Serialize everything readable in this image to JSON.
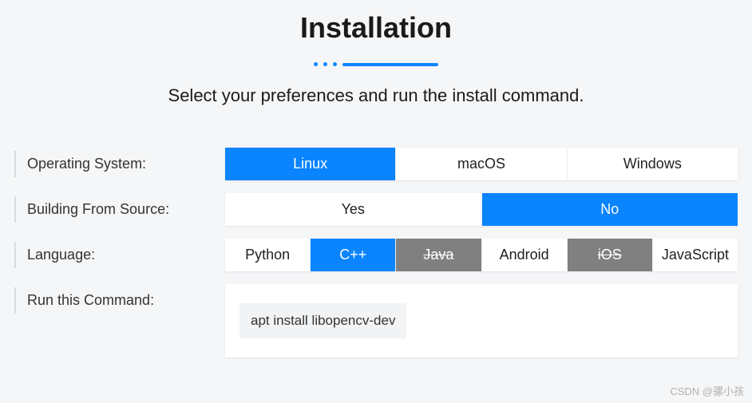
{
  "header": {
    "title": "Installation",
    "subtitle": "Select your preferences and run the install command."
  },
  "labels": {
    "os": "Operating System:",
    "source": "Building From Source:",
    "language": "Language:",
    "command": "Run this Command:"
  },
  "os_options": [
    {
      "label": "Linux",
      "state": "selected"
    },
    {
      "label": "macOS",
      "state": "normal"
    },
    {
      "label": "Windows",
      "state": "normal"
    }
  ],
  "source_options": [
    {
      "label": "Yes",
      "state": "normal"
    },
    {
      "label": "No",
      "state": "selected"
    }
  ],
  "language_options": [
    {
      "label": "Python",
      "state": "normal"
    },
    {
      "label": "C++",
      "state": "selected"
    },
    {
      "label": "Java",
      "state": "disabled"
    },
    {
      "label": "Android",
      "state": "normal"
    },
    {
      "label": "iOS",
      "state": "disabled"
    },
    {
      "label": "JavaScript",
      "state": "normal"
    }
  ],
  "command": "apt install libopencv-dev",
  "watermark": "CSDN @骡小孩"
}
